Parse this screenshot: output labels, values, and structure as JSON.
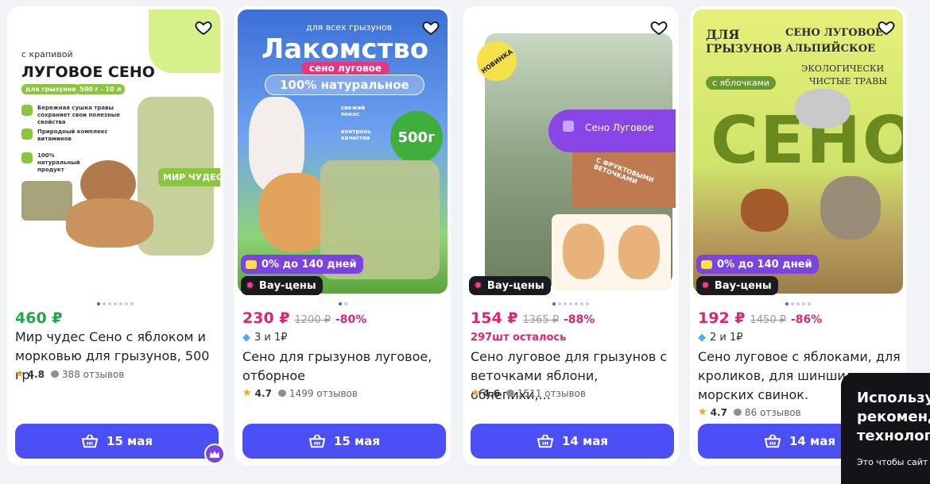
{
  "products": [
    {
      "price": "460 ₽",
      "price_color": "green",
      "title_lines": [
        "Мир чудес Сено с яблоком и",
        "морковью для грызунов, 500 гр."
      ],
      "rating": "4.8",
      "reviews": "388 отзывов",
      "delivery": "15 мая",
      "image_text": {
        "top": "с крапивой",
        "main": "ЛУГОВОЕ СЕНО",
        "pill1": "для грызунов",
        "pill2": "500 г - 10 л",
        "f1": "Бережная сушка травы сохраняет свои полезные свойства",
        "f2": "Природный комплекс витаминов",
        "f3": "100% натуральный продукт",
        "pack": "МИР ЧУДЕС"
      }
    },
    {
      "price": "230 ₽",
      "price_color": "pink",
      "old_price": "1200 ₽",
      "discount": "-80%",
      "promo_sub": "3 и 1₽",
      "title_lines": [
        "Сено для грызунов луговое,",
        "отборное"
      ],
      "rating": "4.7",
      "reviews": "1499 отзывов",
      "delivery": "15 мая",
      "badge_installment": "0% до 140 дней",
      "badge_wow": "Вау-цены",
      "image_text": {
        "top": "для всех грызунов",
        "main": "Лакомство",
        "pill1": "сено луговое",
        "pill2": "100% натуральное",
        "f1": "свежий покос",
        "f2": "контроль качества",
        "weight": "500г"
      }
    },
    {
      "price": "154 ₽",
      "price_color": "pink",
      "old_price": "1365 ₽",
      "discount": "-88%",
      "stock": "297шт осталось",
      "title_lines": [
        "Сено луговое для грызунов с",
        "веточками яблони, облепихи,..."
      ],
      "rating": "4.6",
      "reviews": "1511 отзывов",
      "delivery": "14 мая",
      "badge_wow": "Вау-цены",
      "image_text": {
        "tag": "НОВИНКА",
        "label": "Сено Луговое",
        "sticker": "С ФРУКТОВЫМИ ВЕТОЧКАМИ"
      }
    },
    {
      "price": "192 ₽",
      "price_color": "pink",
      "old_price": "1450 ₽",
      "discount": "-86%",
      "promo_sub": "2 и 1₽",
      "title_lines": [
        "Сено луговое с яблоками, для",
        "кроликов, для шиншилл, для",
        "морских свинок."
      ],
      "rating": "4.7",
      "reviews": "86 отзывов",
      "delivery": "14 мая",
      "badge_installment": "0% до 140 дней",
      "badge_wow": "Вау-цены",
      "image_text": {
        "l1": "ДЛЯ",
        "l2": "ГРЫЗУНОВ",
        "r1": "СЕНО ЛУГОВОЕ",
        "r2": "АЛЬПИЙСКОЕ",
        "eco1": "ЭКОЛОГИЧЕСКИ",
        "eco2": "ЧИСТЫЕ ТРАВЫ",
        "apple": "с яблочками",
        "big": "СЕНО"
      }
    }
  ],
  "popup": {
    "line1": "Использу",
    "line2": "рекоменд",
    "line3": "технологи",
    "small": "Это чтобы сайт"
  },
  "colors": {
    "accent": "#4c4ff5",
    "pink": "#e0246e",
    "green": "#24a64a",
    "installment": "#7b44e0"
  },
  "icons": {
    "favorite": "heart-icon",
    "cart": "basket-icon",
    "rating": "star-icon",
    "reviews": "comment-bubble-icon"
  }
}
